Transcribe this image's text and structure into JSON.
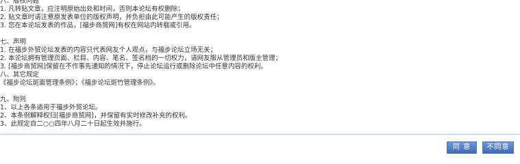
{
  "rules": {
    "section6": {
      "heading": "六、版权问题",
      "items": [
        "1. 凡转贴文章，应注明原始出处和时间，否则本论坛有权删除；",
        "2. 贴文章时请注意原发表单位的版权声明，并负担由此可能产生的版权责任；",
        "3. 您在本论坛发表的作品，[福步商贸网]有权在网站内转载或引用。"
      ]
    },
    "section7": {
      "heading": "七、声明",
      "items": [
        "1. 在福步外贸论坛发表的内容只代表网友个人观点，与福步论坛立场无关；",
        "2. 本论坛拥有管理页面、栏目、内容、笔名、签名档的一切权力，请网友服从管理员和版主管理；",
        "3. [福步商贸网]保留在不作事先通知的情况下，停止论坛运行或删除论坛中任意内容的权利。"
      ]
    },
    "section8": {
      "heading": "八、其它规定",
      "items": [
        "《福步论坛斑面管理条例》；《福步论坛斑竹管理条例》。"
      ]
    },
    "section9": {
      "heading": "九、附则",
      "items": [
        "1、以上各条适用于福步外贸论坛。",
        "2、本条例解释权归[福步商贸网]，并保留有实时修改补充的权利。",
        "3、此规定自二○○四年八月二十日起生效并施行。"
      ]
    }
  },
  "buttons": {
    "agree": "同 意",
    "disagree": "不同意"
  },
  "colors": {
    "button_bg": "#4f7bc4",
    "separator": "#b3c8e4",
    "text": "#333333"
  }
}
